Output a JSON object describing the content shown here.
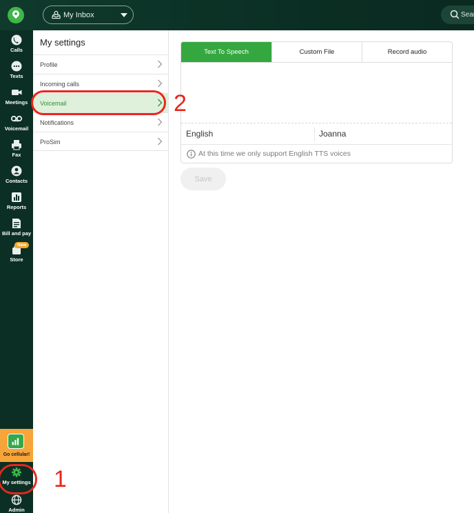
{
  "header": {
    "inbox_label": "My Inbox",
    "search_placeholder": "Sear"
  },
  "nav": {
    "items": [
      {
        "label": "Calls",
        "icon": "phone-icon"
      },
      {
        "label": "Texts",
        "icon": "chat-bubble-icon"
      },
      {
        "label": "Meetings",
        "icon": "video-camera-icon"
      },
      {
        "label": "Voicemail",
        "icon": "voicemail-icon"
      },
      {
        "label": "Fax",
        "icon": "fax-icon"
      },
      {
        "label": "Contacts",
        "icon": "person-icon"
      },
      {
        "label": "Reports",
        "icon": "bar-chart-icon"
      },
      {
        "label": "Bill and pay",
        "icon": "bill-icon"
      },
      {
        "label": "Store",
        "icon": "store-bag-icon",
        "badge": "New"
      }
    ],
    "go_cellular": "Go cellular!",
    "my_settings": "My settings",
    "admin": "Admin"
  },
  "settings": {
    "title": "My settings",
    "items": [
      {
        "label": "Profile",
        "active": false
      },
      {
        "label": "Incoming calls",
        "active": false
      },
      {
        "label": "Voicemail",
        "active": true
      },
      {
        "label": "Notifications",
        "active": false
      },
      {
        "label": "ProSim",
        "active": false
      }
    ]
  },
  "voicemail": {
    "tabs": [
      {
        "label": "Text To Speech",
        "active": true
      },
      {
        "label": "Custom File",
        "active": false
      },
      {
        "label": "Record audio",
        "active": false
      }
    ],
    "tts_text": "",
    "language": "English",
    "voice": "Joanna",
    "info": "At this time we only support English TTS voices",
    "save_label": "Save"
  },
  "annotations": {
    "step1": "1",
    "step2": "2"
  },
  "colors": {
    "brand_green": "#34a83f",
    "nav_bg": "#0b2f24",
    "annotation_red": "#e8261d",
    "active_row_bg": "#dff0db"
  }
}
